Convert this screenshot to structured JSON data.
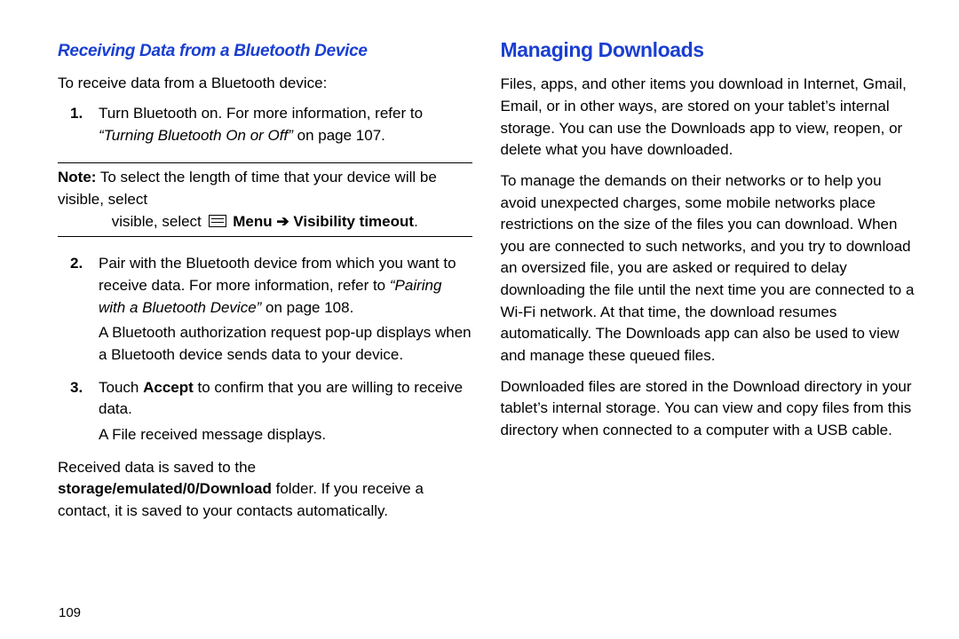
{
  "pageNumber": "109",
  "left": {
    "heading": "Receiving Data from a Bluetooth Device",
    "intro": "To receive data from a Bluetooth device:",
    "step1_num": "1.",
    "step1_a": "Turn Bluetooth on. For more information, refer to ",
    "step1_b": "“Turning Bluetooth On or Off”",
    "step1_c": " on page 107.",
    "note_prefix": "Note:",
    "note_a": " To select the length of time that your device will be visible, select ",
    "note_menu": "Menu",
    "note_arrow": " ➔ ",
    "note_vis": "Visibility timeout",
    "note_end": ".",
    "step2_num": "2.",
    "step2_a": "Pair with the Bluetooth device from which you want to receive data. For more information, refer to ",
    "step2_b": "“Pairing with a Bluetooth Device”",
    "step2_c": " on page 108.",
    "step2_sub": "A Bluetooth authorization request pop-up displays when a Bluetooth device sends data to your device.",
    "step3_num": "3.",
    "step3_a": "Touch ",
    "step3_b": "Accept",
    "step3_c": " to confirm that you are willing to receive data.",
    "step3_sub": "A File received message displays.",
    "footer_a": "Received data is saved to the ",
    "footer_b": "storage/emulated/0/Download",
    "footer_c": " folder. If you receive a contact, it is saved to your contacts automatically."
  },
  "right": {
    "heading": "Managing Downloads",
    "p1": "Files, apps, and other items you download in Internet, Gmail, Email, or in other ways, are stored on your tablet’s internal storage. You can use the Downloads app to view, reopen, or delete what you have downloaded.",
    "p2": "To manage the demands on their networks or to help you avoid unexpected charges, some mobile networks place restrictions on the size of the files you can download. When you are connected to such networks, and you try to download an oversized file, you are asked or required to delay downloading the file until the next time you are connected to a Wi-Fi network. At that time, the download resumes automatically. The Downloads app can also be used to view and manage these queued files.",
    "p3": "Downloaded files are stored in the Download directory in your tablet’s internal storage. You can view and copy files from this directory when connected to a computer with a USB cable."
  }
}
